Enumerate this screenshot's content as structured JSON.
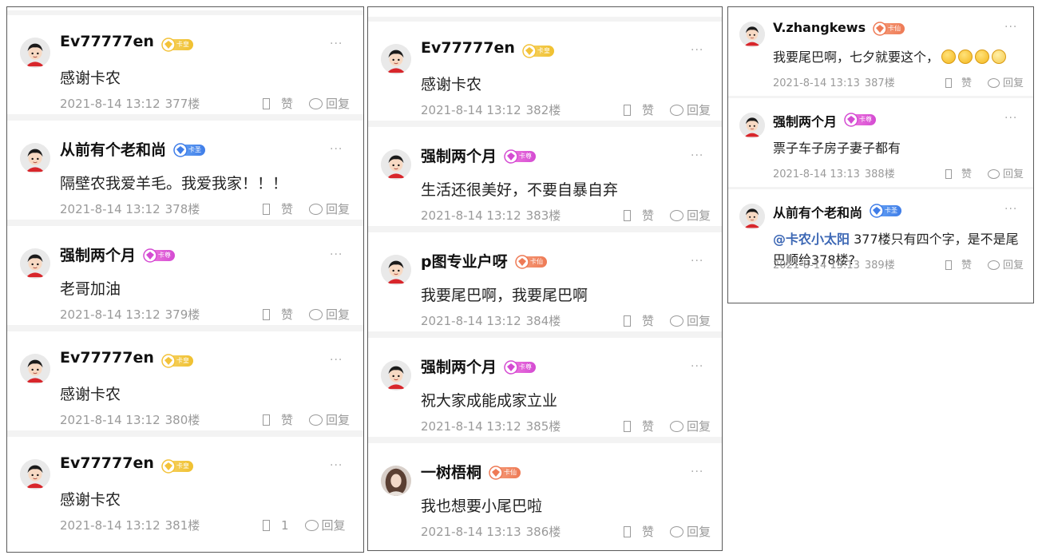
{
  "panels": [
    {
      "comments": [
        {
          "user": "Ev77777en",
          "badge": {
            "text": "卡皇",
            "style": "gold"
          },
          "text": "感谢卡农",
          "time": "2021-8-14 13:12",
          "floor": "377楼",
          "like": "赞",
          "reply": "回复",
          "avatar": "cartoon"
        },
        {
          "user": "从前有个老和尚",
          "badge": {
            "text": "卡圣",
            "style": "blue"
          },
          "text": "隔壁农我爱羊毛。我爱我家！！！",
          "time": "2021-8-14 13:12",
          "floor": "378楼",
          "like": "赞",
          "reply": "回复",
          "avatar": "cartoon"
        },
        {
          "user": "强制两个月",
          "badge": {
            "text": "卡尊",
            "style": "pink"
          },
          "text": "老哥加油",
          "time": "2021-8-14 13:12",
          "floor": "379楼",
          "like": "赞",
          "reply": "回复",
          "avatar": "cartoon"
        },
        {
          "user": "Ev77777en",
          "badge": {
            "text": "卡皇",
            "style": "gold"
          },
          "text": "感谢卡农",
          "time": "2021-8-14 13:12",
          "floor": "380楼",
          "like": "赞",
          "reply": "回复",
          "avatar": "cartoon"
        },
        {
          "user": "Ev77777en",
          "badge": {
            "text": "卡皇",
            "style": "gold"
          },
          "text": "感谢卡农",
          "time": "2021-8-14 13:12",
          "floor": "381楼",
          "like": "1",
          "reply": "回复",
          "avatar": "cartoon"
        }
      ]
    },
    {
      "comments": [
        {
          "user": "Ev77777en",
          "badge": {
            "text": "卡皇",
            "style": "gold"
          },
          "text": "感谢卡农",
          "time": "2021-8-14 13:12",
          "floor": "382楼",
          "like": "赞",
          "reply": "回复",
          "avatar": "cartoon"
        },
        {
          "user": "强制两个月",
          "badge": {
            "text": "卡尊",
            "style": "pink"
          },
          "text": "生活还很美好，不要自暴自弃",
          "time": "2021-8-14 13:12",
          "floor": "383楼",
          "like": "赞",
          "reply": "回复",
          "avatar": "cartoon"
        },
        {
          "user": "p图专业户呀",
          "badge": {
            "text": "卡仙",
            "style": "orange"
          },
          "text": "我要尾巴啊，我要尾巴啊",
          "time": "2021-8-14 13:12",
          "floor": "384楼",
          "like": "赞",
          "reply": "回复",
          "avatar": "cartoon"
        },
        {
          "user": "强制两个月",
          "badge": {
            "text": "卡尊",
            "style": "pink"
          },
          "text": "祝大家成能成家立业",
          "time": "2021-8-14 13:12",
          "floor": "385楼",
          "like": "赞",
          "reply": "回复",
          "avatar": "cartoon"
        },
        {
          "user": "一树梧桐",
          "badge": {
            "text": "卡仙",
            "style": "orange"
          },
          "text": "我也想要小尾巴啦",
          "time": "2021-8-14 13:13",
          "floor": "386楼",
          "like": "赞",
          "reply": "回复",
          "avatar": "photo"
        }
      ]
    },
    {
      "comments": [
        {
          "user": "V.zhangkews",
          "badge": {
            "text": "卡仙",
            "style": "orange"
          },
          "text": "我要尾巴啊，七夕就要这个，",
          "emojis": [
            "smirk-emoji",
            "smirk-emoji",
            "smirk-emoji",
            "dizzy-emoji"
          ],
          "time": "2021-8-14 13:13",
          "floor": "387楼",
          "like": "赞",
          "reply": "回复",
          "avatar": "cartoon"
        },
        {
          "user": "强制两个月",
          "badge": {
            "text": "卡尊",
            "style": "pink"
          },
          "text": "票子车子房子妻子都有",
          "time": "2021-8-14 13:13",
          "floor": "388楼",
          "like": "赞",
          "reply": "回复",
          "avatar": "cartoon"
        },
        {
          "user": "从前有个老和尚",
          "badge": {
            "text": "卡圣",
            "style": "blue"
          },
          "mention": "@卡农小太阳",
          "text": " 377楼只有四个字，是不是尾巴顺给378楼?",
          "time": "2021-8-14 13:13",
          "floor": "389楼",
          "like": "赞",
          "reply": "回复",
          "avatar": "cartoon"
        }
      ]
    }
  ],
  "more_icon": "···"
}
